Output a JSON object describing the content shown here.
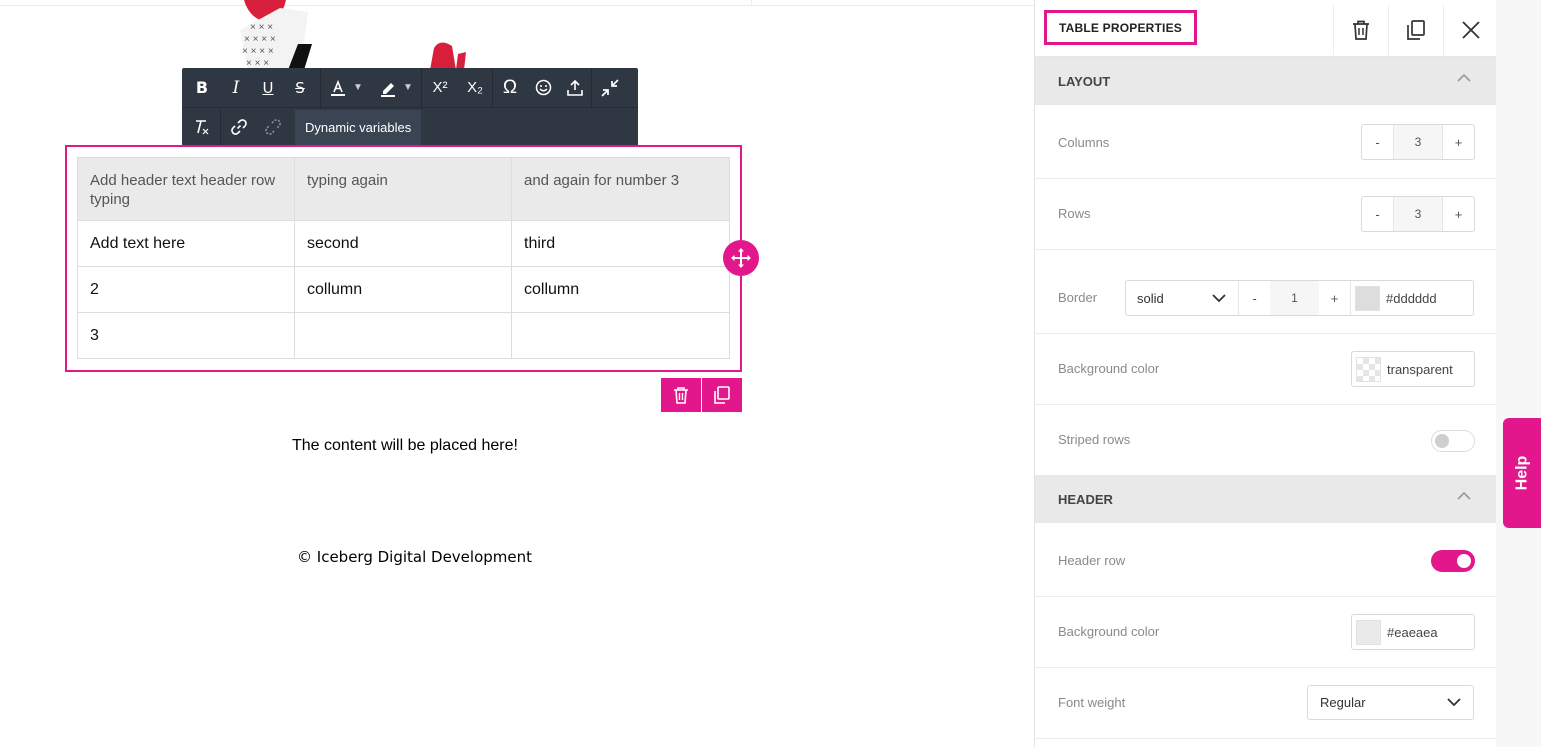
{
  "colors": {
    "accent": "#e3178c",
    "toolbar_bg": "#2f3742",
    "header_bg": "#eaeaea",
    "border": "#dddddd",
    "deco_red": "#d81f3b"
  },
  "toolbar": {
    "buttons_row1": [
      "B",
      "I",
      "U",
      "S"
    ],
    "icons_row1": [
      "text-color-icon",
      "highlight-icon",
      "superscript-icon",
      "subscript-icon",
      "special-chars-icon",
      "emoji-icon",
      "upload-icon",
      "collapse-icon"
    ],
    "superscript_label": "X²",
    "subscript_label": "X₂",
    "omega_label": "Ω",
    "clear_format_label": "Tx",
    "dynamic_variables_label": "Dynamic variables"
  },
  "table": {
    "headers": [
      "Add header text header row typing",
      "typing again",
      "and again for number 3"
    ],
    "rows": [
      [
        "Add text here",
        "second",
        "third"
      ],
      [
        "2",
        "collumn",
        "collumn"
      ],
      [
        "3",
        "",
        ""
      ]
    ]
  },
  "content": {
    "placeholder": "The content will be placed here!",
    "footer": "© Iceberg Digital Development"
  },
  "panel": {
    "title": "TABLE PROPERTIES",
    "layout_section": "LAYOUT",
    "header_section": "HEADER",
    "columns_label": "Columns",
    "columns_value": "3",
    "rows_label": "Rows",
    "rows_value": "3",
    "minus": "-",
    "plus": "+",
    "border_label": "Border",
    "border_style": "solid",
    "border_width": "1",
    "border_color": "#dddddd",
    "bg_label": "Background color",
    "bg_value": "transparent",
    "striped_label": "Striped rows",
    "striped_on": false,
    "header_row_label": "Header row",
    "header_row_on": true,
    "header_bg_label": "Background color",
    "header_bg_value": "#eaeaea",
    "font_weight_label": "Font weight",
    "font_weight_value": "Regular"
  },
  "help": {
    "label": "Help"
  }
}
